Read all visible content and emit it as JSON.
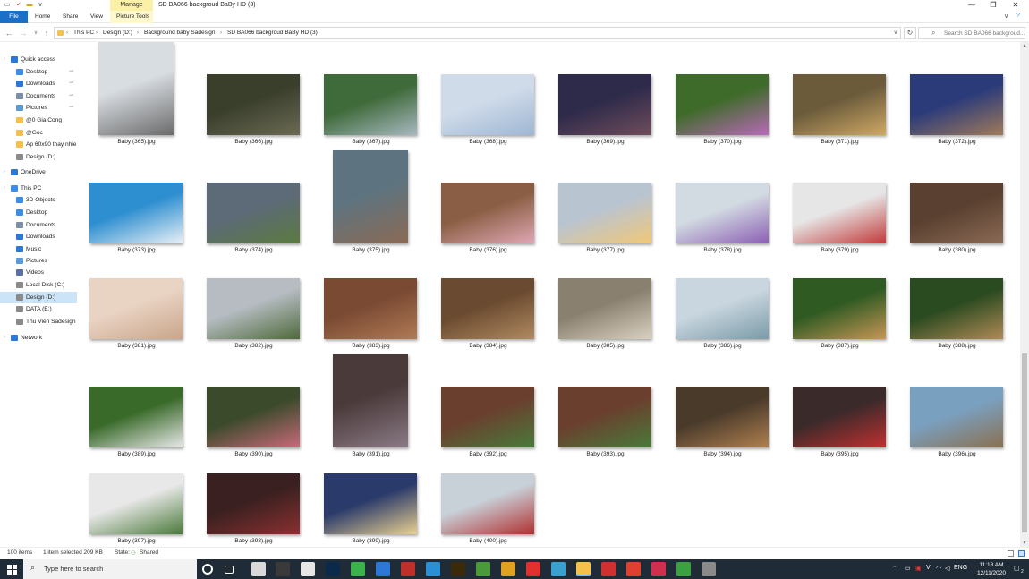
{
  "window": {
    "title": "SD BA066 backgroud BaBy HD (3)",
    "context_tab_group": "Manage",
    "minimize": "—",
    "maximize": "❐",
    "close": "✕"
  },
  "ribbon": {
    "tabs": [
      "File",
      "Home",
      "Share",
      "View",
      "Picture Tools"
    ],
    "expand_icon": "∨",
    "help_icon": "?"
  },
  "address": {
    "breadcrumbs": [
      "This PC",
      "Design (D:)",
      "Background baby Sadesign",
      "SD BA066 backgroud BaBy HD (3)"
    ],
    "search_placeholder": "Search SD BA066 backgroud..."
  },
  "sidebar": {
    "items": [
      {
        "label": "Quick access",
        "icon": "star-icon",
        "color": "#2b78d6",
        "indent": 0,
        "pinned": false,
        "selected": false
      },
      {
        "label": "Desktop",
        "icon": "desktop-icon",
        "color": "#3a8ee6",
        "indent": 1,
        "pinned": true,
        "selected": false
      },
      {
        "label": "Downloads",
        "icon": "download-icon",
        "color": "#2b78d6",
        "indent": 1,
        "pinned": true,
        "selected": false
      },
      {
        "label": "Documents",
        "icon": "documents-icon",
        "color": "#7a8fa6",
        "indent": 1,
        "pinned": true,
        "selected": false
      },
      {
        "label": "Pictures",
        "icon": "pictures-icon",
        "color": "#5a9bd5",
        "indent": 1,
        "pinned": true,
        "selected": false
      },
      {
        "label": "@0 Gia Cong",
        "icon": "folder-icon",
        "color": "#f4c24b",
        "indent": 1,
        "pinned": false,
        "selected": false
      },
      {
        "label": "@Goc",
        "icon": "folder-icon",
        "color": "#f4c24b",
        "indent": 1,
        "pinned": false,
        "selected": false
      },
      {
        "label": "Ap 60x90 thay nhie",
        "icon": "folder-icon",
        "color": "#f4c24b",
        "indent": 1,
        "pinned": false,
        "selected": false
      },
      {
        "label": "Design (D:)",
        "icon": "drive-icon",
        "color": "#8a8a8a",
        "indent": 1,
        "pinned": false,
        "selected": false
      },
      {
        "label": "OneDrive",
        "icon": "cloud-icon",
        "color": "#2b78d6",
        "indent": 0,
        "pinned": false,
        "selected": false
      },
      {
        "label": "This PC",
        "icon": "computer-icon",
        "color": "#3a8ee6",
        "indent": 0,
        "pinned": false,
        "selected": false
      },
      {
        "label": "3D Objects",
        "icon": "cube-icon",
        "color": "#3a8ee6",
        "indent": 1,
        "pinned": false,
        "selected": false
      },
      {
        "label": "Desktop",
        "icon": "desktop-icon",
        "color": "#3a8ee6",
        "indent": 1,
        "pinned": false,
        "selected": false
      },
      {
        "label": "Documents",
        "icon": "documents-icon",
        "color": "#7a8fa6",
        "indent": 1,
        "pinned": false,
        "selected": false
      },
      {
        "label": "Downloads",
        "icon": "download-icon",
        "color": "#2b78d6",
        "indent": 1,
        "pinned": false,
        "selected": false
      },
      {
        "label": "Music",
        "icon": "music-icon",
        "color": "#2b78d6",
        "indent": 1,
        "pinned": false,
        "selected": false
      },
      {
        "label": "Pictures",
        "icon": "pictures-icon",
        "color": "#5a9bd5",
        "indent": 1,
        "pinned": false,
        "selected": false
      },
      {
        "label": "Videos",
        "icon": "videos-icon",
        "color": "#5a6fa6",
        "indent": 1,
        "pinned": false,
        "selected": false
      },
      {
        "label": "Local Disk (C:)",
        "icon": "drive-icon",
        "color": "#8a8a8a",
        "indent": 1,
        "pinned": false,
        "selected": false
      },
      {
        "label": "Design (D:)",
        "icon": "drive-icon",
        "color": "#8a8a8a",
        "indent": 1,
        "pinned": false,
        "selected": true
      },
      {
        "label": "DATA (E:)",
        "icon": "drive-icon",
        "color": "#8a8a8a",
        "indent": 1,
        "pinned": false,
        "selected": false
      },
      {
        "label": "Thu Vien Sadesign",
        "icon": "drive-icon",
        "color": "#8a8a8a",
        "indent": 1,
        "pinned": false,
        "selected": false
      },
      {
        "label": "Network",
        "icon": "network-icon",
        "color": "#2b78d6",
        "indent": 0,
        "pinned": false,
        "selected": false
      }
    ]
  },
  "files": [
    {
      "name": "Baby (365).jpg",
      "orientation": "portrait",
      "colors": [
        "#d8dde2",
        "#6b6b6b"
      ]
    },
    {
      "name": "Baby (366).jpg",
      "orientation": "landscape",
      "colors": [
        "#3a3f2c",
        "#6b6a55"
      ]
    },
    {
      "name": "Baby (367).jpg",
      "orientation": "landscape",
      "colors": [
        "#3f6a3a",
        "#a8b8c0"
      ]
    },
    {
      "name": "Baby (368).jpg",
      "orientation": "landscape",
      "colors": [
        "#cfdbe9",
        "#9fb6d3"
      ]
    },
    {
      "name": "Baby (369).jpg",
      "orientation": "landscape",
      "colors": [
        "#2e2a4a",
        "#6f4d5b"
      ]
    },
    {
      "name": "Baby (370).jpg",
      "orientation": "landscape",
      "colors": [
        "#3f6b2a",
        "#b86ab8"
      ]
    },
    {
      "name": "Baby (371).jpg",
      "orientation": "landscape",
      "colors": [
        "#6b5b3b",
        "#cfa866"
      ]
    },
    {
      "name": "Baby (372).jpg",
      "orientation": "landscape",
      "colors": [
        "#2b3b7a",
        "#a07a5a"
      ]
    },
    {
      "name": "Baby (373).jpg",
      "orientation": "landscape",
      "colors": [
        "#2e8fd0",
        "#e8f0f6"
      ]
    },
    {
      "name": "Baby (374).jpg",
      "orientation": "landscape",
      "colors": [
        "#5d6a78",
        "#5b7a3f"
      ]
    },
    {
      "name": "Baby (375).jpg",
      "orientation": "portrait",
      "colors": [
        "#5d7480",
        "#8a6a55"
      ]
    },
    {
      "name": "Baby (376).jpg",
      "orientation": "landscape",
      "colors": [
        "#8a5e44",
        "#e0a7b5"
      ]
    },
    {
      "name": "Baby (377).jpg",
      "orientation": "landscape",
      "colors": [
        "#b9c4d1",
        "#f0c878"
      ]
    },
    {
      "name": "Baby (378).jpg",
      "orientation": "landscape",
      "colors": [
        "#d3dbe2",
        "#8b5fb3"
      ]
    },
    {
      "name": "Baby (379).jpg",
      "orientation": "landscape",
      "colors": [
        "#e6e6e6",
        "#c23a3a"
      ]
    },
    {
      "name": "Baby (380).jpg",
      "orientation": "landscape",
      "colors": [
        "#5a4030",
        "#8a6a55"
      ]
    },
    {
      "name": "Baby (381).jpg",
      "orientation": "landscape",
      "colors": [
        "#e9d3c3",
        "#c9a58a"
      ]
    },
    {
      "name": "Baby (382).jpg",
      "orientation": "landscape",
      "colors": [
        "#b6bcc2",
        "#4e6a3a"
      ]
    },
    {
      "name": "Baby (383).jpg",
      "orientation": "landscape",
      "colors": [
        "#7a4a33",
        "#b07a55"
      ]
    },
    {
      "name": "Baby (384).jpg",
      "orientation": "landscape",
      "colors": [
        "#6a4a30",
        "#b08a60"
      ]
    },
    {
      "name": "Baby (385).jpg",
      "orientation": "landscape",
      "colors": [
        "#8a8070",
        "#d8d0c0"
      ]
    },
    {
      "name": "Baby (386).jpg",
      "orientation": "landscape",
      "colors": [
        "#c9d6df",
        "#7a9ba8"
      ]
    },
    {
      "name": "Baby (387).jpg",
      "orientation": "landscape",
      "colors": [
        "#2f5a22",
        "#c79655"
      ]
    },
    {
      "name": "Baby (388).jpg",
      "orientation": "landscape",
      "colors": [
        "#2a4a1f",
        "#b08a55"
      ]
    },
    {
      "name": "Baby (389).jpg",
      "orientation": "landscape",
      "colors": [
        "#3a6a2a",
        "#e8e8e8"
      ]
    },
    {
      "name": "Baby (390).jpg",
      "orientation": "landscape",
      "colors": [
        "#3a4a2a",
        "#c96a7a"
      ]
    },
    {
      "name": "Baby (391).jpg",
      "orientation": "portrait",
      "colors": [
        "#4a3a3a",
        "#8a7a85"
      ]
    },
    {
      "name": "Baby (392).jpg",
      "orientation": "landscape",
      "colors": [
        "#6a3f2e",
        "#4a7a3a"
      ]
    },
    {
      "name": "Baby (393).jpg",
      "orientation": "landscape",
      "colors": [
        "#6a3f2e",
        "#4a7a3a"
      ]
    },
    {
      "name": "Baby (394).jpg",
      "orientation": "landscape",
      "colors": [
        "#4a3a2a",
        "#b08050"
      ]
    },
    {
      "name": "Baby (395).jpg",
      "orientation": "landscape",
      "colors": [
        "#3a2a2a",
        "#c03030"
      ]
    },
    {
      "name": "Baby (396).jpg",
      "orientation": "landscape",
      "colors": [
        "#7aa0c0",
        "#8a7050"
      ]
    },
    {
      "name": "Baby (397).jpg",
      "orientation": "landscape",
      "colors": [
        "#e8e8e8",
        "#4a7a3a"
      ]
    },
    {
      "name": "Baby (398).jpg",
      "orientation": "landscape",
      "colors": [
        "#3a2020",
        "#8a3030"
      ]
    },
    {
      "name": "Baby (399).jpg",
      "orientation": "landscape",
      "colors": [
        "#2a3a6a",
        "#e8d090"
      ]
    },
    {
      "name": "Baby (400).jpg",
      "orientation": "landscape",
      "colors": [
        "#c8d0d8",
        "#b03030"
      ]
    }
  ],
  "status": {
    "items_count": "100 items",
    "selection": "1 item selected  209 KB",
    "state": "State:",
    "state_value": "Shared"
  },
  "taskbar": {
    "search_text": "Type here to search",
    "apps": [
      {
        "icon": "cortana-icon",
        "color": "#1f2b36",
        "active": false
      },
      {
        "icon": "task-view-icon",
        "color": "#1f2b36",
        "active": false
      },
      {
        "icon": "app-icon",
        "color": "#d9d9d9",
        "active": false
      },
      {
        "icon": "app-icon",
        "color": "#3a3a3a",
        "active": false
      },
      {
        "icon": "app-icon",
        "color": "#e6e6e6",
        "active": false
      },
      {
        "icon": "photoshop-icon",
        "color": "#0b2a4a",
        "active": false
      },
      {
        "icon": "app-icon",
        "color": "#3bb34a",
        "active": false
      },
      {
        "icon": "app-icon",
        "color": "#2b78d6",
        "active": false
      },
      {
        "icon": "filezilla-icon",
        "color": "#c0302a",
        "active": false
      },
      {
        "icon": "app-icon",
        "color": "#2b8fd6",
        "active": false
      },
      {
        "icon": "bridge-icon",
        "color": "#3a2a0a",
        "active": false
      },
      {
        "icon": "app-icon",
        "color": "#4a9a3a",
        "active": false
      },
      {
        "icon": "chrome-icon",
        "color": "#e0a020",
        "active": false
      },
      {
        "icon": "app-icon",
        "color": "#e03030",
        "active": false
      },
      {
        "icon": "app-icon",
        "color": "#3aa0d0",
        "active": false
      },
      {
        "icon": "file-explorer-icon",
        "color": "#f4c24b",
        "active": true
      },
      {
        "icon": "app-icon",
        "color": "#d03030",
        "active": false
      },
      {
        "icon": "chrome-icon",
        "color": "#e04030",
        "active": false
      },
      {
        "icon": "app-icon",
        "color": "#d03050",
        "active": false
      },
      {
        "icon": "chrome-icon",
        "color": "#3aa040",
        "active": false
      },
      {
        "icon": "app-icon",
        "color": "#8a8a8a",
        "active": false
      }
    ],
    "language": "ENG",
    "time": "11:18 AM",
    "date": "12/11/2020",
    "notification_badge": "2"
  }
}
